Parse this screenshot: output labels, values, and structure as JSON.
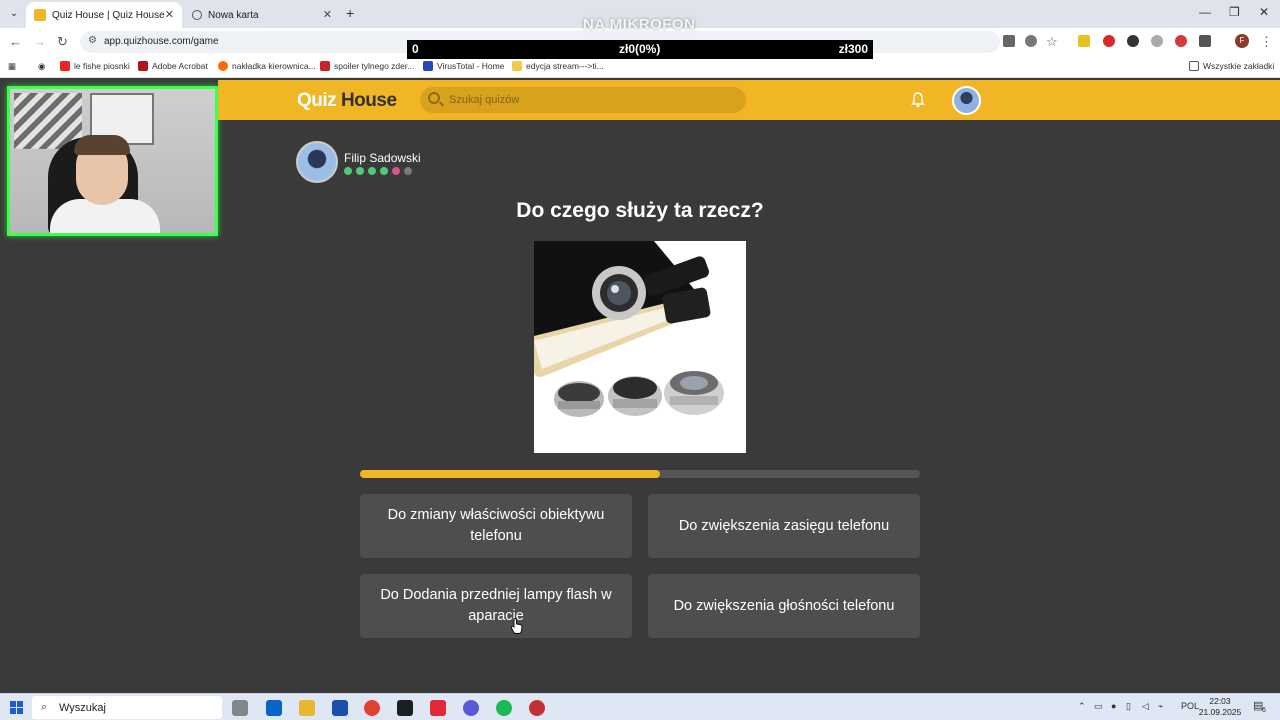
{
  "browser": {
    "tabs": [
      {
        "title": "Quiz House | Quiz House",
        "active": true
      },
      {
        "title": "Nowa karta",
        "active": false
      }
    ],
    "url": "app.quizhouse.com/game",
    "bookmarks": [
      "le fishe piosnki",
      "Adobe Acrobat",
      "nakładka kierownica...",
      "spoiler tylnego zder...",
      "VirusTotal - Home",
      "edycja stream--->ti..."
    ],
    "all_bookmarks": "Wszystkie zakładki",
    "profile_initial": "F"
  },
  "overlay": {
    "title": "NA MIKROFON",
    "score_left": "0",
    "score_center": "zł0(0%)",
    "score_right": "zł300"
  },
  "site": {
    "logo_quiz": "Quiz",
    "logo_house": "House",
    "search_placeholder": "Szukaj quizów",
    "accent": "#f1b625"
  },
  "game": {
    "player_name": "Filip Sadowski",
    "streak_dots": [
      "#4fc97a",
      "#4fc97a",
      "#4fc97a",
      "#4fc97a",
      "#d7558a",
      "#7a7a7a"
    ],
    "question": "Do czego służy ta rzecz?",
    "progress": 0.535,
    "answers": [
      "Do zmiany właściwości obiektywu telefonu",
      "Do zwiększenia zasięgu telefonu",
      "Do Dodania przedniej lampy flash w aparacie",
      "Do zwiększenia głośności telefonu"
    ]
  },
  "taskbar": {
    "search": "Wyszukaj",
    "language": "POL",
    "time": "22:03",
    "date": "21.09.2025",
    "notifications": "6"
  }
}
